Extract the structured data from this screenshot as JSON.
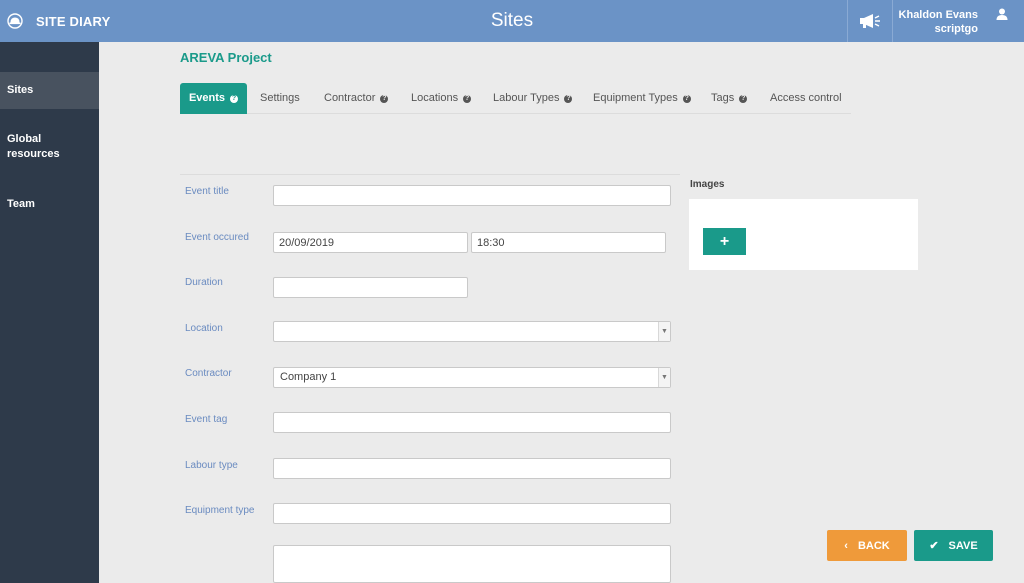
{
  "app": {
    "brand": "SITE DIARY",
    "page_title": "Sites"
  },
  "user": {
    "name": "Khaldon Evans",
    "org": "scriptgo"
  },
  "sidebar": {
    "items": [
      {
        "label": "Sites",
        "active": true
      },
      {
        "label": "Global resources"
      },
      {
        "label": "Team"
      }
    ]
  },
  "project": {
    "title": "AREVA Project"
  },
  "tabs": [
    {
      "label": "Events",
      "active": true,
      "help": true
    },
    {
      "label": "Settings"
    },
    {
      "label": "Contractor",
      "help": true
    },
    {
      "label": "Locations",
      "help": true
    },
    {
      "label": "Labour Types",
      "help": true
    },
    {
      "label": "Equipment Types",
      "help": true
    },
    {
      "label": "Tags",
      "help": true
    },
    {
      "label": "Access control"
    }
  ],
  "form": {
    "event_title": {
      "label": "Event title",
      "value": ""
    },
    "event_occured": {
      "label": "Event occured",
      "date": "20/09/2019",
      "time": "18:30"
    },
    "duration": {
      "label": "Duration",
      "value": ""
    },
    "location": {
      "label": "Location",
      "value": ""
    },
    "contractor": {
      "label": "Contractor",
      "value": "Company 1"
    },
    "event_tag": {
      "label": "Event tag",
      "value": ""
    },
    "labour_type": {
      "label": "Labour type",
      "value": ""
    },
    "equipment_type": {
      "label": "Equipment type",
      "value": ""
    }
  },
  "images": {
    "label": "Images",
    "add_label": "+"
  },
  "buttons": {
    "back": "BACK",
    "save": "SAVE"
  },
  "icons": {
    "brand": "helmet-icon",
    "announcements": "megaphone-icon",
    "user": "user-icon",
    "help": "question-circle-icon",
    "back": "chevron-left-icon",
    "save": "check-icon"
  },
  "colors": {
    "topbar": "#6b93c6",
    "sidebar": "#2e3a4a",
    "accent": "#1a9a8a",
    "back": "#ef9a3a"
  }
}
